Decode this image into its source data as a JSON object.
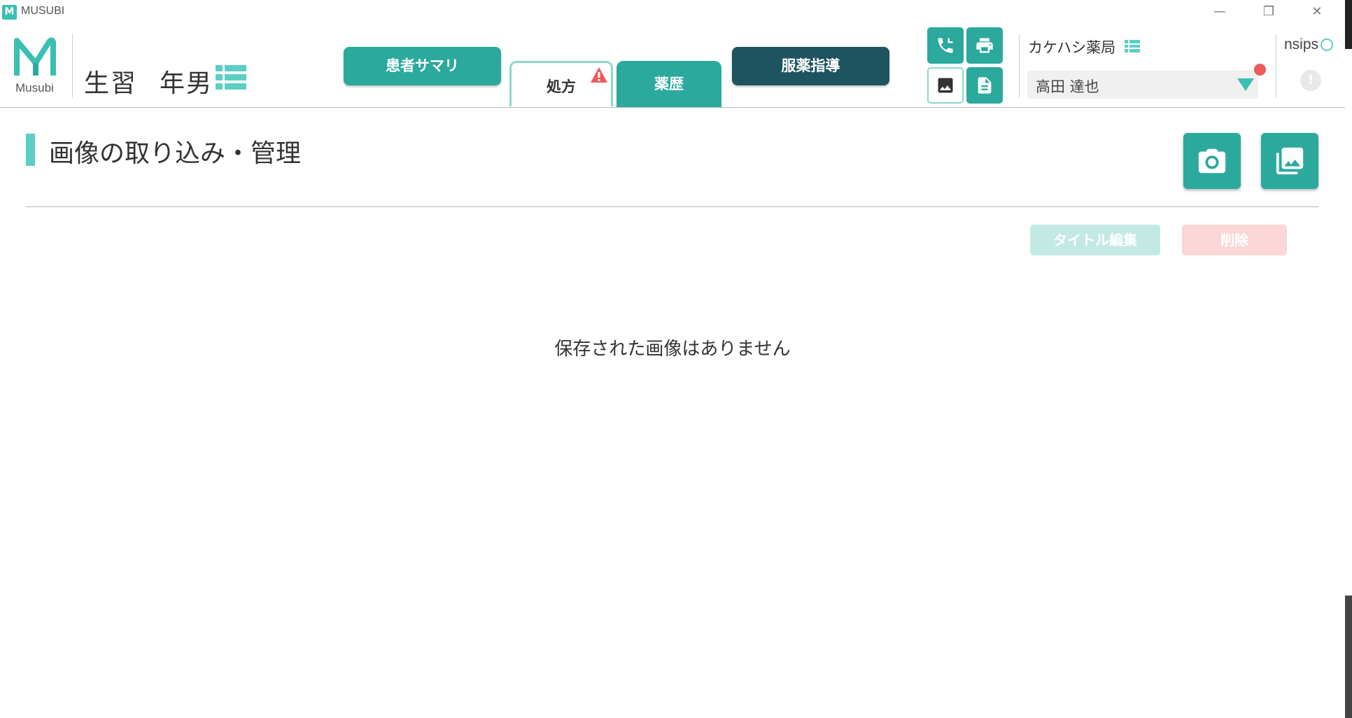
{
  "window": {
    "app_icon_letter": "M",
    "title": "MUSUBI",
    "minimize_glyph": "—",
    "restore_glyph": "❐",
    "close_glyph": "✕"
  },
  "header": {
    "logo_text": "Musubi",
    "patient_name": "生習",
    "patient_age_gender": "年男",
    "tabs": {
      "summary": "患者サマリ",
      "prescription": "処方",
      "history": "薬歴",
      "guidance": "服薬指導"
    },
    "pharmacy_name": "カケハシ薬局",
    "pharmacist": "高田 達也",
    "nsips_label": "nsips",
    "info_glyph": "!"
  },
  "main": {
    "title": "画像の取り込み・管理",
    "edit_title_button": "タイトル編集",
    "delete_button": "削除",
    "empty_message": "保存された画像はありません"
  },
  "icons": [
    "phone-icon",
    "print-icon",
    "image-icon",
    "document-icon",
    "camera-icon",
    "gallery-icon",
    "warning-icon",
    "list-icon"
  ],
  "colors": {
    "teal": "#2ba99d",
    "light_teal": "#5ccfc4",
    "dark_teal": "#1e545f",
    "alert_red": "#ee5a5a"
  }
}
